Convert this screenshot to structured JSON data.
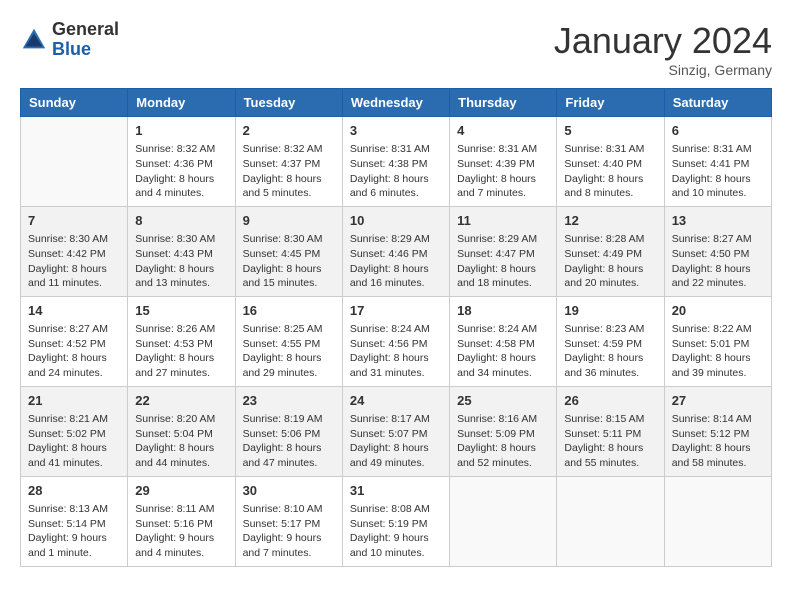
{
  "header": {
    "logo_general": "General",
    "logo_blue": "Blue",
    "month_title": "January 2024",
    "location": "Sinzig, Germany"
  },
  "weekdays": [
    "Sunday",
    "Monday",
    "Tuesday",
    "Wednesday",
    "Thursday",
    "Friday",
    "Saturday"
  ],
  "weeks": [
    [
      {
        "day": "",
        "sunrise": "",
        "sunset": "",
        "daylight": ""
      },
      {
        "day": "1",
        "sunrise": "Sunrise: 8:32 AM",
        "sunset": "Sunset: 4:36 PM",
        "daylight": "Daylight: 8 hours and 4 minutes."
      },
      {
        "day": "2",
        "sunrise": "Sunrise: 8:32 AM",
        "sunset": "Sunset: 4:37 PM",
        "daylight": "Daylight: 8 hours and 5 minutes."
      },
      {
        "day": "3",
        "sunrise": "Sunrise: 8:31 AM",
        "sunset": "Sunset: 4:38 PM",
        "daylight": "Daylight: 8 hours and 6 minutes."
      },
      {
        "day": "4",
        "sunrise": "Sunrise: 8:31 AM",
        "sunset": "Sunset: 4:39 PM",
        "daylight": "Daylight: 8 hours and 7 minutes."
      },
      {
        "day": "5",
        "sunrise": "Sunrise: 8:31 AM",
        "sunset": "Sunset: 4:40 PM",
        "daylight": "Daylight: 8 hours and 8 minutes."
      },
      {
        "day": "6",
        "sunrise": "Sunrise: 8:31 AM",
        "sunset": "Sunset: 4:41 PM",
        "daylight": "Daylight: 8 hours and 10 minutes."
      }
    ],
    [
      {
        "day": "7",
        "sunrise": "Sunrise: 8:30 AM",
        "sunset": "Sunset: 4:42 PM",
        "daylight": "Daylight: 8 hours and 11 minutes."
      },
      {
        "day": "8",
        "sunrise": "Sunrise: 8:30 AM",
        "sunset": "Sunset: 4:43 PM",
        "daylight": "Daylight: 8 hours and 13 minutes."
      },
      {
        "day": "9",
        "sunrise": "Sunrise: 8:30 AM",
        "sunset": "Sunset: 4:45 PM",
        "daylight": "Daylight: 8 hours and 15 minutes."
      },
      {
        "day": "10",
        "sunrise": "Sunrise: 8:29 AM",
        "sunset": "Sunset: 4:46 PM",
        "daylight": "Daylight: 8 hours and 16 minutes."
      },
      {
        "day": "11",
        "sunrise": "Sunrise: 8:29 AM",
        "sunset": "Sunset: 4:47 PM",
        "daylight": "Daylight: 8 hours and 18 minutes."
      },
      {
        "day": "12",
        "sunrise": "Sunrise: 8:28 AM",
        "sunset": "Sunset: 4:49 PM",
        "daylight": "Daylight: 8 hours and 20 minutes."
      },
      {
        "day": "13",
        "sunrise": "Sunrise: 8:27 AM",
        "sunset": "Sunset: 4:50 PM",
        "daylight": "Daylight: 8 hours and 22 minutes."
      }
    ],
    [
      {
        "day": "14",
        "sunrise": "Sunrise: 8:27 AM",
        "sunset": "Sunset: 4:52 PM",
        "daylight": "Daylight: 8 hours and 24 minutes."
      },
      {
        "day": "15",
        "sunrise": "Sunrise: 8:26 AM",
        "sunset": "Sunset: 4:53 PM",
        "daylight": "Daylight: 8 hours and 27 minutes."
      },
      {
        "day": "16",
        "sunrise": "Sunrise: 8:25 AM",
        "sunset": "Sunset: 4:55 PM",
        "daylight": "Daylight: 8 hours and 29 minutes."
      },
      {
        "day": "17",
        "sunrise": "Sunrise: 8:24 AM",
        "sunset": "Sunset: 4:56 PM",
        "daylight": "Daylight: 8 hours and 31 minutes."
      },
      {
        "day": "18",
        "sunrise": "Sunrise: 8:24 AM",
        "sunset": "Sunset: 4:58 PM",
        "daylight": "Daylight: 8 hours and 34 minutes."
      },
      {
        "day": "19",
        "sunrise": "Sunrise: 8:23 AM",
        "sunset": "Sunset: 4:59 PM",
        "daylight": "Daylight: 8 hours and 36 minutes."
      },
      {
        "day": "20",
        "sunrise": "Sunrise: 8:22 AM",
        "sunset": "Sunset: 5:01 PM",
        "daylight": "Daylight: 8 hours and 39 minutes."
      }
    ],
    [
      {
        "day": "21",
        "sunrise": "Sunrise: 8:21 AM",
        "sunset": "Sunset: 5:02 PM",
        "daylight": "Daylight: 8 hours and 41 minutes."
      },
      {
        "day": "22",
        "sunrise": "Sunrise: 8:20 AM",
        "sunset": "Sunset: 5:04 PM",
        "daylight": "Daylight: 8 hours and 44 minutes."
      },
      {
        "day": "23",
        "sunrise": "Sunrise: 8:19 AM",
        "sunset": "Sunset: 5:06 PM",
        "daylight": "Daylight: 8 hours and 47 minutes."
      },
      {
        "day": "24",
        "sunrise": "Sunrise: 8:17 AM",
        "sunset": "Sunset: 5:07 PM",
        "daylight": "Daylight: 8 hours and 49 minutes."
      },
      {
        "day": "25",
        "sunrise": "Sunrise: 8:16 AM",
        "sunset": "Sunset: 5:09 PM",
        "daylight": "Daylight: 8 hours and 52 minutes."
      },
      {
        "day": "26",
        "sunrise": "Sunrise: 8:15 AM",
        "sunset": "Sunset: 5:11 PM",
        "daylight": "Daylight: 8 hours and 55 minutes."
      },
      {
        "day": "27",
        "sunrise": "Sunrise: 8:14 AM",
        "sunset": "Sunset: 5:12 PM",
        "daylight": "Daylight: 8 hours and 58 minutes."
      }
    ],
    [
      {
        "day": "28",
        "sunrise": "Sunrise: 8:13 AM",
        "sunset": "Sunset: 5:14 PM",
        "daylight": "Daylight: 9 hours and 1 minute."
      },
      {
        "day": "29",
        "sunrise": "Sunrise: 8:11 AM",
        "sunset": "Sunset: 5:16 PM",
        "daylight": "Daylight: 9 hours and 4 minutes."
      },
      {
        "day": "30",
        "sunrise": "Sunrise: 8:10 AM",
        "sunset": "Sunset: 5:17 PM",
        "daylight": "Daylight: 9 hours and 7 minutes."
      },
      {
        "day": "31",
        "sunrise": "Sunrise: 8:08 AM",
        "sunset": "Sunset: 5:19 PM",
        "daylight": "Daylight: 9 hours and 10 minutes."
      },
      {
        "day": "",
        "sunrise": "",
        "sunset": "",
        "daylight": ""
      },
      {
        "day": "",
        "sunrise": "",
        "sunset": "",
        "daylight": ""
      },
      {
        "day": "",
        "sunrise": "",
        "sunset": "",
        "daylight": ""
      }
    ]
  ]
}
